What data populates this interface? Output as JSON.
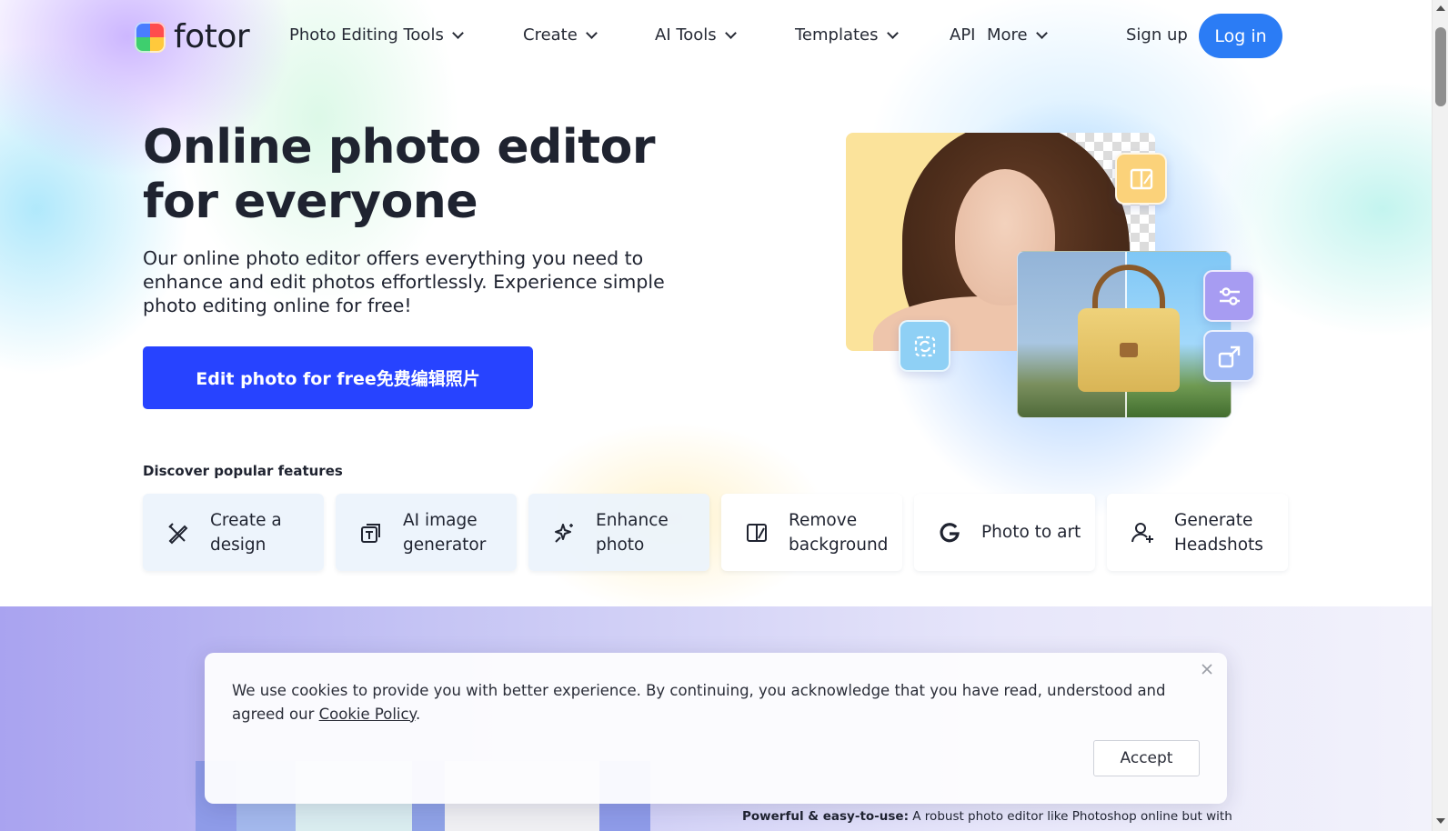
{
  "nav": {
    "logo_text": "fotor",
    "items": [
      {
        "label": "Photo Editing Tools",
        "has_dropdown": true
      },
      {
        "label": "Create",
        "has_dropdown": true
      },
      {
        "label": "AI Tools",
        "has_dropdown": true
      },
      {
        "label": "Templates",
        "has_dropdown": true
      },
      {
        "label": "API",
        "has_dropdown": false
      },
      {
        "label": "More",
        "has_dropdown": true
      }
    ],
    "signup_label": "Sign up",
    "login_label": "Log in"
  },
  "hero": {
    "title": "Online photo editor for everyone",
    "description": "Our online photo editor offers everything you need to enhance and edit photos effortlessly. Experience simple photo editing online for free!",
    "cta_label": "Edit photo for free免费编辑照片"
  },
  "features": {
    "heading": "Discover popular features",
    "items": [
      {
        "label": "Create a design",
        "icon": "pencil-ruler-icon"
      },
      {
        "label": "AI image generator",
        "icon": "ai-image-icon"
      },
      {
        "label": "Enhance photo",
        "icon": "sparkle-enhance-icon"
      },
      {
        "label": "Remove background",
        "icon": "remove-background-icon"
      },
      {
        "label": "Photo to art",
        "icon": "art-g-icon"
      },
      {
        "label": "Generate Headshots",
        "icon": "user-plus-icon"
      }
    ]
  },
  "lower": {
    "powerful_bold": "Powerful & easy-to-use:",
    "powerful_text": " A robust photo editor like Photoshop online but with"
  },
  "cookie": {
    "text": "We use cookies to provide you with better experience. By continuing, you acknowledge that you have read, understood and agreed our ",
    "link_label": "Cookie Policy",
    "text_end": ".",
    "accept_label": "Accept"
  },
  "colors": {
    "brand_blue": "#2b7cf5",
    "cta_blue": "#2743ff",
    "text_dark": "#1f2330"
  }
}
